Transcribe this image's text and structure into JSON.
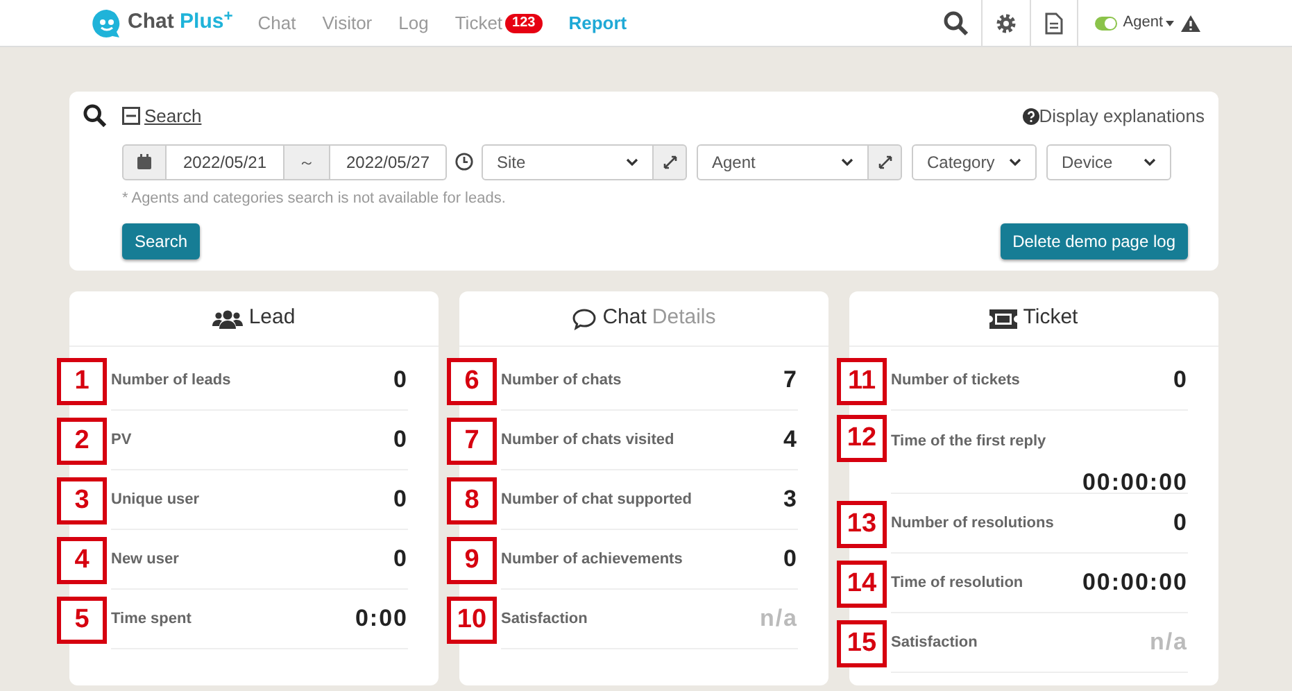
{
  "header": {
    "logo": {
      "first": "Chat",
      "second": "Plus$^{+}$"
    },
    "nav": [
      {
        "label": "Chat",
        "selected": false
      },
      {
        "label": "Visitor",
        "selected": false
      },
      {
        "label": "Log",
        "selected": false
      },
      {
        "label": "Ticket",
        "selected": false,
        "badge": "123"
      },
      {
        "label": "Report",
        "selected": true
      }
    ],
    "agent": {
      "label": "Agent",
      "on": true
    }
  },
  "search_panel": {
    "toggle_label": "Search",
    "help": "Display explanations",
    "date_from": "2022/05/21",
    "range_separator": "～",
    "date_to": "2022/05/27",
    "selects": [
      {
        "label": "Site",
        "expandable": true
      },
      {
        "label": "Agent",
        "expandable": true
      },
      {
        "label": "Category",
        "expandable": false
      },
      {
        "label": "Device",
        "expandable": false
      }
    ],
    "note": "* Agents and categories search is not available for leads.",
    "search_button": "Search",
    "delete_button": "Delete demo page log"
  },
  "cards": [
    {
      "kind": "lead",
      "title": "Lead",
      "rows": [
        {
          "marker": "1",
          "label": "Number of leads",
          "value": "0",
          "muted": false,
          "kind": "inline"
        },
        {
          "marker": "2",
          "label": "PV",
          "value": "0",
          "muted": false,
          "kind": "inline"
        },
        {
          "marker": "3",
          "label": "Unique user",
          "value": "0",
          "muted": false,
          "kind": "inline"
        },
        {
          "marker": "4",
          "label": "New user",
          "value": "0",
          "muted": false,
          "kind": "inline"
        },
        {
          "marker": "5",
          "label": "Time spent",
          "value": "0:00",
          "muted": false,
          "kind": "inline"
        }
      ]
    },
    {
      "kind": "chat",
      "title": "Chat",
      "subtitle": "Details",
      "rows": [
        {
          "marker": "6",
          "label": "Number of chats",
          "value": "7",
          "muted": false,
          "kind": "inline"
        },
        {
          "marker": "7",
          "label": "Number of chats visited",
          "value": "4",
          "muted": false,
          "kind": "inline"
        },
        {
          "marker": "8",
          "label": "Number of chat supported",
          "value": "3",
          "muted": false,
          "kind": "inline"
        },
        {
          "marker": "9",
          "label": "Number of achievements",
          "value": "0",
          "muted": false,
          "kind": "inline"
        },
        {
          "marker": "10",
          "label": "Satisfaction",
          "value": "n/a",
          "muted": true,
          "kind": "inline"
        }
      ]
    },
    {
      "kind": "ticket",
      "title": "Ticket",
      "rows": [
        {
          "marker": "11",
          "label": "Number of tickets",
          "value": "0",
          "muted": false,
          "kind": "inline"
        },
        {
          "marker": "12",
          "label": "Time of the first reply",
          "value": "00:00:00",
          "muted": false,
          "kind": "stacked"
        },
        {
          "marker": "13",
          "label": "Number of resolutions",
          "value": "0",
          "muted": false,
          "kind": "inline"
        },
        {
          "marker": "14",
          "label": "Time of resolution",
          "value": "00:00:00",
          "muted": false,
          "kind": "inline"
        },
        {
          "marker": "15",
          "label": "Satisfaction",
          "value": "n/a",
          "muted": true,
          "kind": "inline"
        }
      ]
    }
  ]
}
